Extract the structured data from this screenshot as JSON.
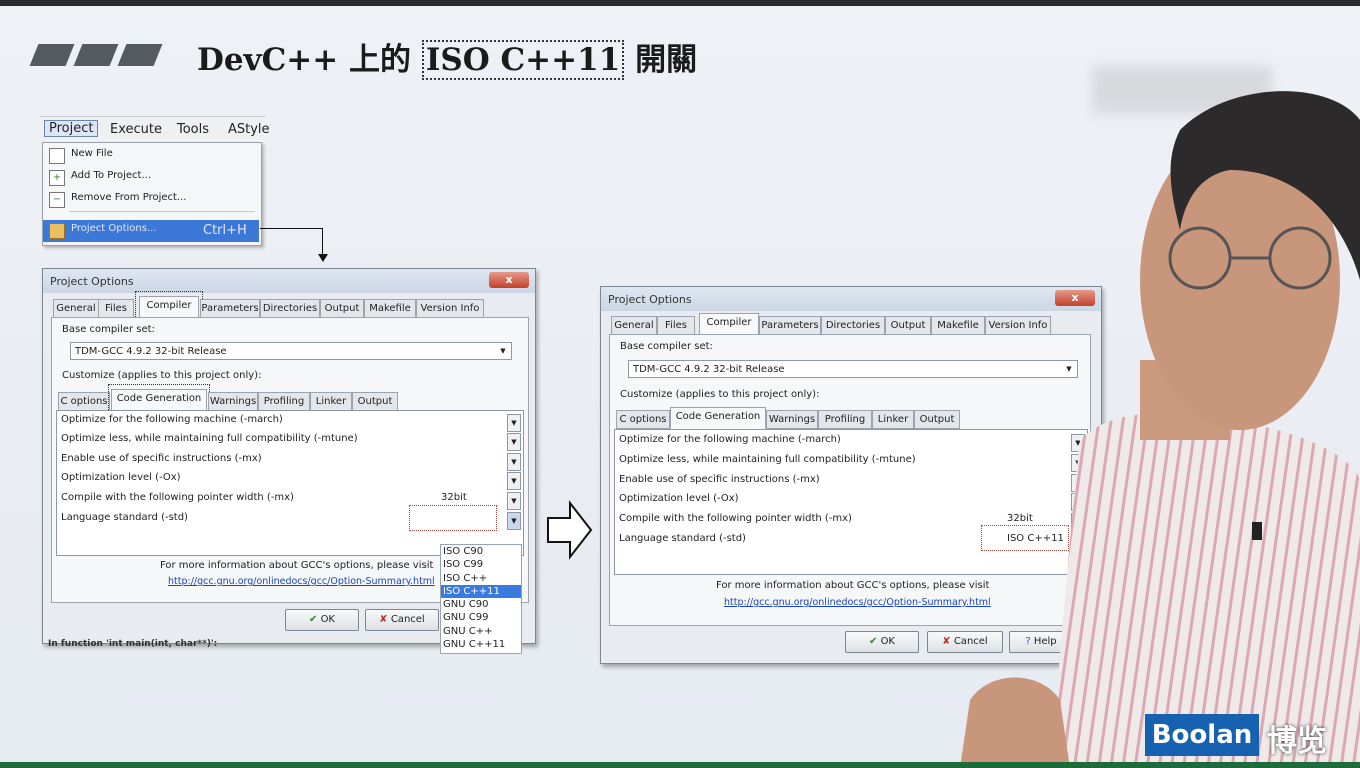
{
  "slide": {
    "title_pre": "DevC++ 上的 ",
    "title_highlight": "ISO C++11",
    "title_post": " 開關"
  },
  "menu": {
    "bar": [
      "Project",
      "Execute",
      "Tools",
      "AStyle"
    ],
    "items": {
      "new_file": "New File",
      "add_to_project": "Add To Project...",
      "remove_from_project": "Remove From Project...",
      "project_options": "Project Options...",
      "project_options_shortcut": "Ctrl+H"
    }
  },
  "dialog": {
    "title": "Project Options",
    "close": "x",
    "tabs": [
      "General",
      "Files",
      "Compiler",
      "Parameters",
      "Directories",
      "Output",
      "Makefile",
      "Version Info"
    ],
    "base_compiler_label": "Base compiler set:",
    "base_compiler_value": "TDM-GCC 4.9.2 32-bit Release",
    "customize_label": "Customize (applies to this project only):",
    "subtabs": [
      "C options",
      "Code Generation",
      "Warnings",
      "Profiling",
      "Linker",
      "Output"
    ],
    "options": [
      "Optimize for the following machine (-march)",
      "Optimize less, while maintaining full compatibility (-mtune)",
      "Enable use of specific instructions (-mx)",
      "Optimization level (-Ox)",
      "Compile with the following pointer width (-mx)",
      "Language standard (-std)"
    ],
    "pointer_width_value": "32bit",
    "language_standard_value": "ISO C++11",
    "info_text": "For more information about GCC's options, please visit",
    "info_link": "http://gcc.gnu.org/onlinedocs/gcc/Option-Summary.html",
    "ok": "OK",
    "cancel": "Cancel",
    "help": "Help"
  },
  "std_list": [
    "ISO C90",
    "ISO C99",
    "ISO C++",
    "ISO C++11",
    "GNU C90",
    "GNU C99",
    "GNU C++",
    "GNU C++11"
  ],
  "std_list_selected": "ISO C++11",
  "background_text": "In function 'int main(int, char**)':",
  "logo": {
    "brand": "Boolan",
    "cn": "博览"
  },
  "colors": {
    "highlight_blue": "#3a7be0",
    "logo_blue": "#1762b0",
    "dotted_red": "#b0463c"
  }
}
